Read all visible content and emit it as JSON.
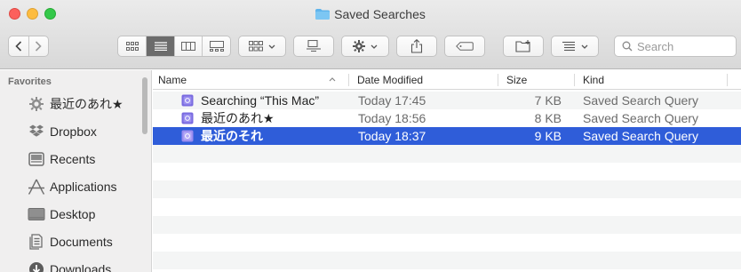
{
  "window": {
    "title": "Saved Searches"
  },
  "toolbar": {
    "search_placeholder": "Search"
  },
  "sidebar": {
    "heading": "Favorites",
    "items": [
      {
        "label": "最近のあれ★",
        "icon": "gear-icon"
      },
      {
        "label": "Dropbox",
        "icon": "dropbox-icon"
      },
      {
        "label": "Recents",
        "icon": "recents-icon"
      },
      {
        "label": "Applications",
        "icon": "applications-icon"
      },
      {
        "label": "Desktop",
        "icon": "desktop-icon"
      },
      {
        "label": "Documents",
        "icon": "documents-icon"
      },
      {
        "label": "Downloads",
        "icon": "downloads-icon"
      }
    ]
  },
  "columns": {
    "name": "Name",
    "date": "Date Modified",
    "size": "Size",
    "kind": "Kind"
  },
  "files": [
    {
      "name": "Searching “This Mac”",
      "date": "Today 17:45",
      "size": "7 KB",
      "kind": "Saved Search Query",
      "selected": false
    },
    {
      "name": "最近のあれ★",
      "date": "Today 18:56",
      "size": "8 KB",
      "kind": "Saved Search Query",
      "selected": false
    },
    {
      "name": "最近のそれ",
      "date": "Today 18:37",
      "size": "9 KB",
      "kind": "Saved Search Query",
      "selected": true
    }
  ],
  "colors": {
    "selection": "#2f5dd9",
    "file_icon": "#7a6be0"
  }
}
